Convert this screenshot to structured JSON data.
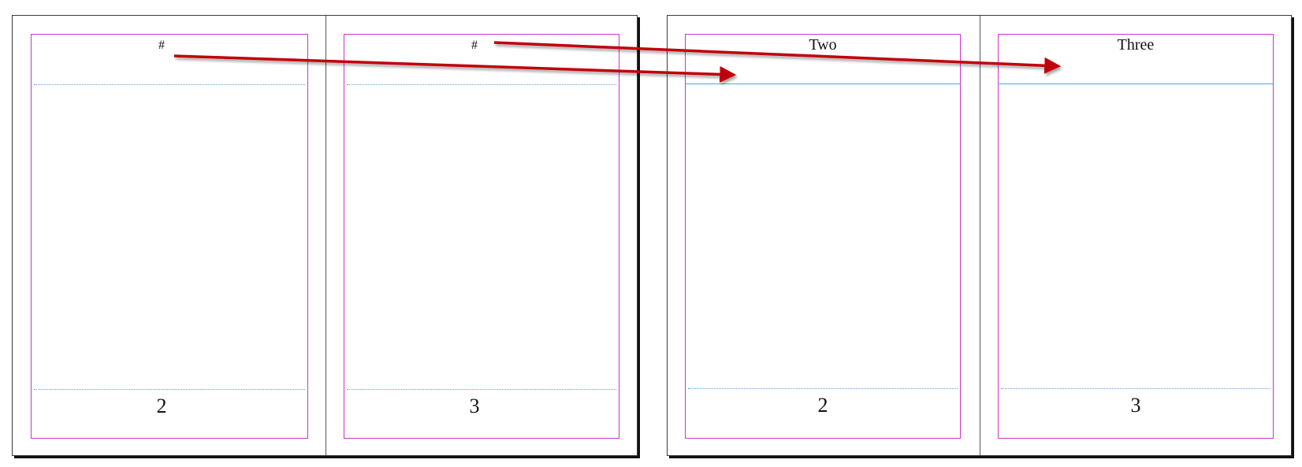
{
  "left_spread": {
    "pages": [
      {
        "header": "#",
        "footer": "2"
      },
      {
        "header": "#",
        "footer": "3"
      }
    ]
  },
  "right_spread": {
    "pages": [
      {
        "header": "Two",
        "footer": "2"
      },
      {
        "header": "Three",
        "footer": "3"
      }
    ]
  },
  "colors": {
    "margin_guide": "#cc33cc",
    "column_guide": "#4da3f0",
    "arrow": "#c0000a"
  }
}
